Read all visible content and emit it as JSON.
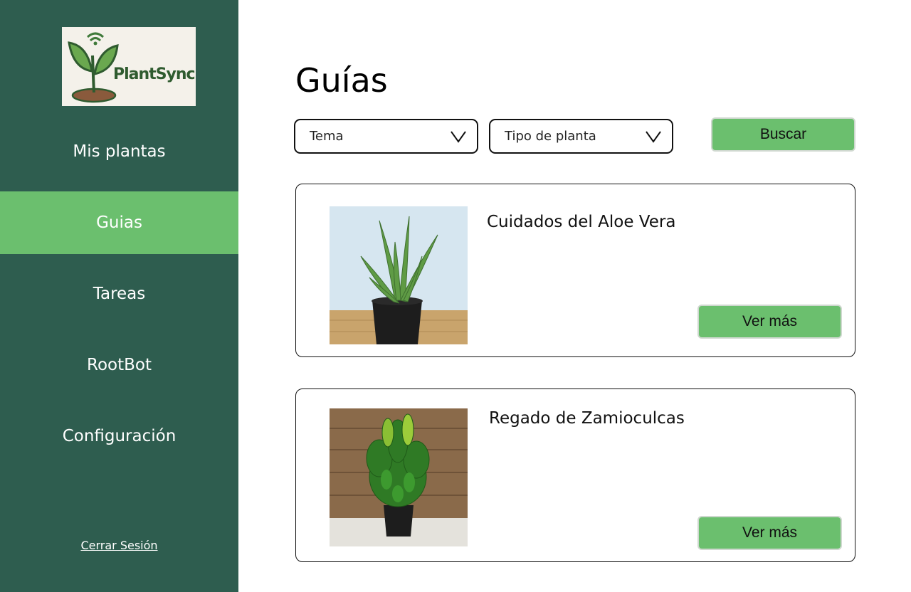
{
  "app": {
    "name": "PlantSync"
  },
  "sidebar": {
    "items": [
      {
        "label": "Mis plantas",
        "active": false
      },
      {
        "label": "Guias",
        "active": true
      },
      {
        "label": "Tareas",
        "active": false
      },
      {
        "label": "RootBot",
        "active": false
      },
      {
        "label": "Configuración",
        "active": false
      }
    ],
    "logout_label": "Cerrar Sesión"
  },
  "main": {
    "title": "Guías",
    "filters": {
      "topic": {
        "value": "Tema"
      },
      "plant_type": {
        "value": "Tipo de planta"
      },
      "search_label": "Buscar"
    },
    "guides": [
      {
        "title": "Cuidados del Aloe Vera",
        "button_label": "Ver más",
        "image": "aloe-vera-photo"
      },
      {
        "title": "Regado de Zamioculcas",
        "button_label": "Ver más",
        "image": "zamioculcas-photo"
      }
    ]
  },
  "colors": {
    "sidebar_bg": "#2e5d4f",
    "accent_green": "#6bbf6e",
    "logo_bg": "#f4f1ea"
  }
}
